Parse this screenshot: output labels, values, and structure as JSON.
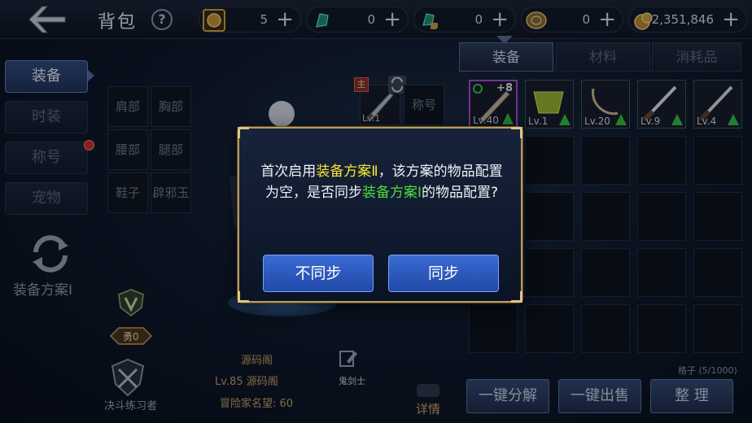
{
  "header": {
    "title": "背包",
    "help_label": "?",
    "currencies": [
      {
        "icon": "gold-coin-box-icon",
        "value": "5",
        "plus": "+"
      },
      {
        "icon": "green-crystal-icon",
        "value": "0",
        "plus": "+"
      },
      {
        "icon": "locked-crystal-icon",
        "value": "0",
        "plus": "+"
      },
      {
        "icon": "bronze-token-icon",
        "value": "0",
        "plus": "+"
      },
      {
        "icon": "gold-pouch-icon",
        "value": "2,351,846",
        "plus": "+"
      }
    ]
  },
  "sidebar": {
    "tabs": [
      "装备",
      "时装",
      "称号",
      "宠物"
    ],
    "scheme_label": "装备方案Ⅰ"
  },
  "equipment": {
    "slots": [
      "肩部",
      "胸部",
      "腰部",
      "腿部",
      "鞋子",
      "辟邪玉"
    ],
    "main_badge": "主",
    "weapon_level": "Lv.1",
    "title_slot": "称号"
  },
  "character": {
    "combat_label": "勇0",
    "duel_label": "决斗练习者",
    "guild": "源码阁",
    "level_line": "Lv.85 源码阁",
    "fame": "冒险家名望: 60",
    "job": "鬼剑士",
    "detail_label": "详情"
  },
  "inventory": {
    "tabs": [
      "装备",
      "材料",
      "消耗品"
    ],
    "items": [
      {
        "level": "Lv.40",
        "enhance": "+8",
        "upgrade": true,
        "rarity": "purple"
      },
      {
        "level": "Lv.1",
        "upgrade": true
      },
      {
        "level": "Lv.20",
        "upgrade": true
      },
      {
        "level": "Lv.9",
        "upgrade": true
      },
      {
        "level": "Lv.4",
        "upgrade": true
      }
    ],
    "slot_count": "格子 (5/1000)",
    "actions": [
      "一键分解",
      "一键出售",
      "整 理"
    ]
  },
  "dialog": {
    "msg_part1": "首次启用",
    "scheme2": "装备方案Ⅱ",
    "msg_part2": "，该方案的物品配置为空，是否同步",
    "scheme1": "装备方案Ⅰ",
    "msg_part3": "的物品配置?",
    "cancel_label": "不同步",
    "confirm_label": "同步"
  },
  "colors": {
    "accent_blue": "#2149a8",
    "highlight_yellow": "#f5e536",
    "highlight_green": "#4fdc3c",
    "gold_border": "#b89b60"
  }
}
